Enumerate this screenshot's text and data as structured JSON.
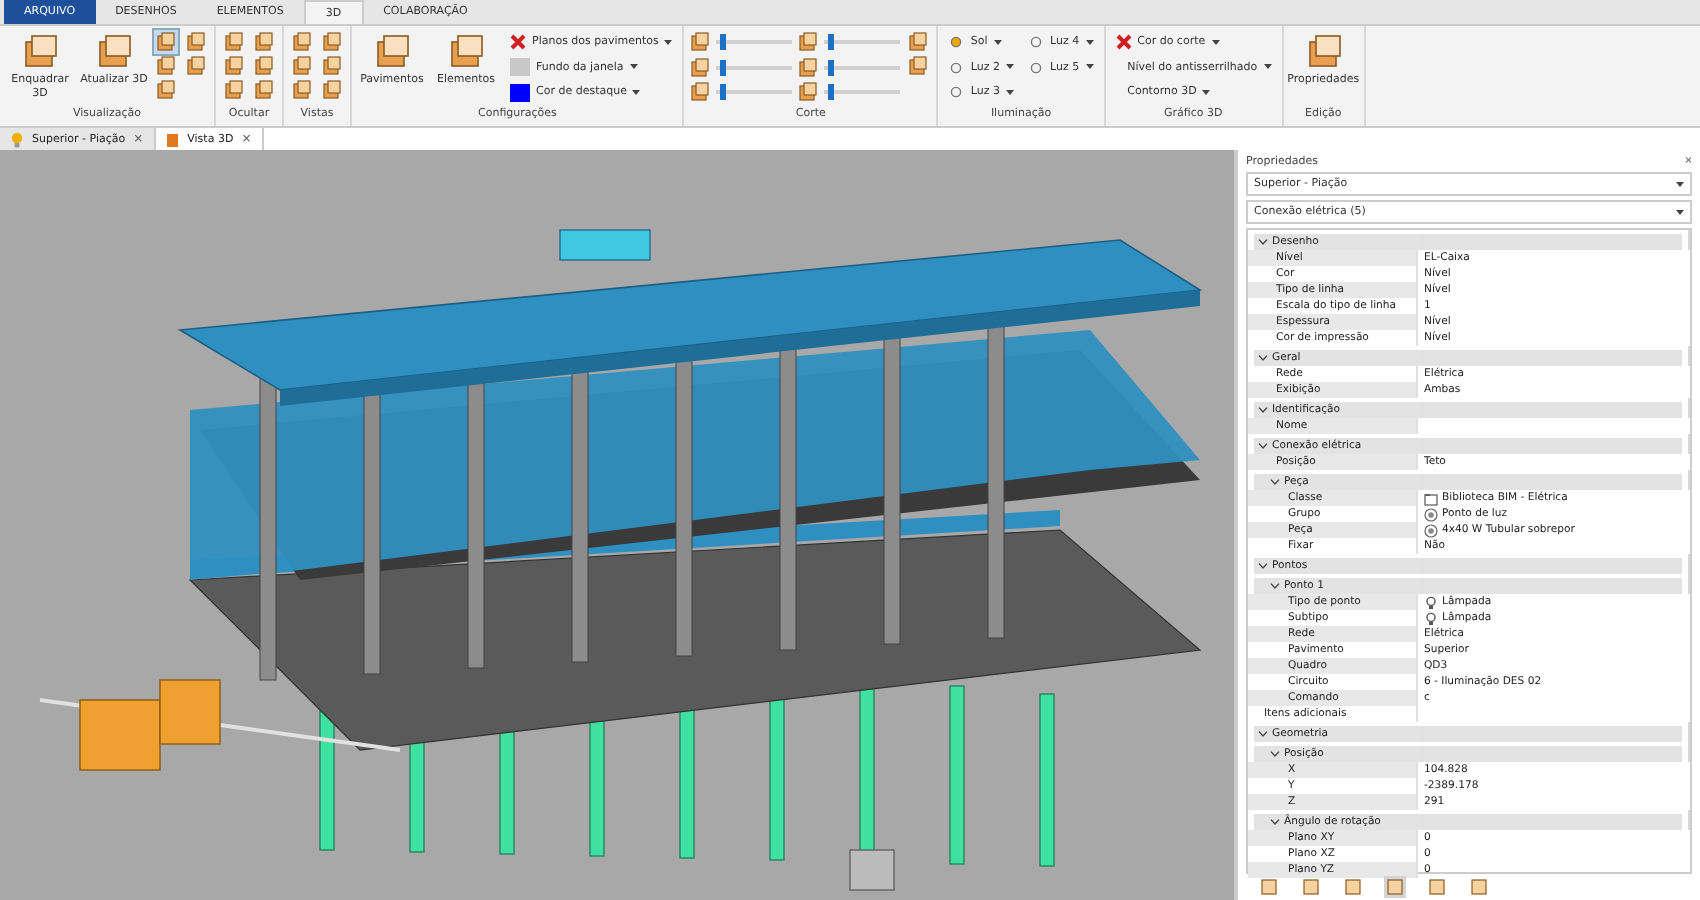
{
  "ribbon_tabs": [
    {
      "label": "ARQUIVO",
      "kind": "file",
      "selected": false
    },
    {
      "label": "DESENHOS",
      "kind": "tab",
      "selected": false
    },
    {
      "label": "ELEMENTOS",
      "kind": "tab",
      "selected": false
    },
    {
      "label": "3D",
      "kind": "tab",
      "selected": true
    },
    {
      "label": "COLABORAÇÃO",
      "kind": "tab",
      "selected": false
    }
  ],
  "ribbon_groups": [
    {
      "label": "Visualização",
      "controls": [
        {
          "kind": "large",
          "label": "Enquadrar 3D"
        },
        {
          "kind": "large",
          "label": "Atualizar 3D"
        },
        {
          "kind": "icon",
          "selected": true
        },
        {
          "kind": "icon",
          "selected": false
        },
        {
          "kind": "icon",
          "selected": false
        },
        {
          "kind": "icon",
          "selected": false
        },
        {
          "kind": "icon",
          "selected": false
        }
      ]
    },
    {
      "label": "Ocultar",
      "controls": [
        {
          "kind": "icon",
          "selected": false
        },
        {
          "kind": "icon",
          "selected": false
        },
        {
          "kind": "icon",
          "selected": false
        },
        {
          "kind": "icon",
          "selected": false
        },
        {
          "kind": "icon",
          "selected": false
        },
        {
          "kind": "icon",
          "selected": false
        }
      ]
    },
    {
      "label": "Vistas",
      "controls": [
        {
          "kind": "icon",
          "selected": false
        },
        {
          "kind": "icon",
          "selected": false
        },
        {
          "kind": "icon",
          "selected": false
        },
        {
          "kind": "icon",
          "selected": false
        },
        {
          "kind": "icon",
          "selected": false
        },
        {
          "kind": "icon",
          "selected": false
        }
      ]
    },
    {
      "label": "Configurações",
      "controls": [
        {
          "kind": "large",
          "label": "Pavimentos"
        },
        {
          "kind": "large",
          "label": "Elementos"
        },
        {
          "kind": "toggle",
          "label": "Planos dos pavimentos",
          "dropdown": true
        },
        {
          "kind": "swatch",
          "label": "Fundo da janela",
          "color": "#c8c8c8",
          "dropdown": true
        },
        {
          "kind": "swatch",
          "label": "Cor de destaque",
          "color": "#0000ff",
          "dropdown": true
        }
      ]
    },
    {
      "label": "Corte",
      "controls": [
        {
          "kind": "slider",
          "level": 0.05
        },
        {
          "kind": "slider",
          "level": 0.05
        },
        {
          "kind": "slider",
          "level": 0.05
        },
        {
          "kind": "slider",
          "level": 0.05
        },
        {
          "kind": "slider",
          "level": 0.05
        },
        {
          "kind": "slider",
          "level": 0.05
        },
        {
          "kind": "icon",
          "selected": false
        },
        {
          "kind": "icon",
          "selected": false
        }
      ]
    },
    {
      "label": "Iluminação",
      "controls": [
        {
          "kind": "menu",
          "label": "Sol",
          "dropdown": true
        },
        {
          "kind": "menu",
          "label": "Luz 2",
          "dropdown": true
        },
        {
          "kind": "menu",
          "label": "Luz 3",
          "dropdown": true
        },
        {
          "kind": "menu",
          "label": "Luz 4",
          "dropdown": true
        },
        {
          "kind": "menu",
          "label": "Luz 5",
          "dropdown": true
        }
      ]
    },
    {
      "label": "Gráfico 3D",
      "controls": [
        {
          "kind": "toggle",
          "label": "Cor do corte",
          "dropdown": true
        },
        {
          "kind": "text",
          "label": "Nível do antisserrilhado",
          "dropdown": true
        },
        {
          "kind": "text",
          "label": "Contorno 3D",
          "dropdown": true
        }
      ]
    },
    {
      "label": "Edição",
      "controls": [
        {
          "kind": "large",
          "label": "Propriedades"
        }
      ]
    }
  ],
  "document_tabs": [
    {
      "label": "Superior - Piação",
      "close": "×",
      "selected": false
    },
    {
      "label": "Vista 3D",
      "close": "×",
      "selected": true
    }
  ],
  "properties": {
    "title": "Propriedades",
    "close": "×",
    "floor_select": "Superior - Piação",
    "selection_select": "Conexão elétrica (5)",
    "rows": [
      {
        "kind": "group",
        "label": "Desenho",
        "expanded": true,
        "children": [
          {
            "kind": "text",
            "label": "Nível",
            "value": "EL-Caixa"
          },
          {
            "kind": "text",
            "label": "Cor",
            "value": "Nível"
          },
          {
            "kind": "text",
            "label": "Tipo de linha",
            "value": "Nível"
          },
          {
            "kind": "text",
            "label": "Escala do tipo de linha",
            "value": "1"
          },
          {
            "kind": "text",
            "label": "Espessura",
            "value": "Nível"
          },
          {
            "kind": "text",
            "label": "Cor de impressão",
            "value": "Nível"
          }
        ]
      },
      {
        "kind": "group",
        "label": "Geral",
        "expanded": true,
        "children": [
          {
            "kind": "text",
            "label": "Rede",
            "value": "Elétrica"
          },
          {
            "kind": "text",
            "label": "Exibição",
            "value": "Ambas"
          }
        ]
      },
      {
        "kind": "group",
        "label": "Identificação",
        "expanded": true,
        "children": [
          {
            "kind": "text",
            "label": "Nome"
          }
        ]
      },
      {
        "kind": "group",
        "label": "Conexão elétrica",
        "expanded": true,
        "children": [
          {
            "kind": "text",
            "label": "Posição",
            "value": "Teto"
          },
          {
            "kind": "group",
            "label": "Peça",
            "expanded": true,
            "children": [
              {
                "kind": "library",
                "label": "Classe",
                "value": "Biblioteca BIM - Elétrica"
              },
              {
                "kind": "part",
                "label": "Grupo",
                "value": "Ponto de luz"
              },
              {
                "kind": "part",
                "label": "Peça",
                "value": "4x40 W Tubular sobrepor"
              },
              {
                "kind": "text",
                "label": "Fixar",
                "value": "Não"
              }
            ]
          }
        ]
      },
      {
        "kind": "group",
        "label": "Pontos",
        "expanded": true,
        "children": [
          {
            "kind": "group",
            "label": "Ponto 1",
            "expanded": true,
            "children": [
              {
                "kind": "lamp",
                "label": "Tipo de ponto",
                "value": "Lâmpada"
              },
              {
                "kind": "lamp",
                "label": "Subtipo",
                "value": "Lâmpada"
              },
              {
                "kind": "text",
                "label": "Rede",
                "value": "Elétrica"
              },
              {
                "kind": "text",
                "label": "Pavimento",
                "value": "Superior"
              },
              {
                "kind": "text",
                "label": "Quadro",
                "value": "QD3"
              },
              {
                "kind": "text",
                "label": "Circuito",
                "value": "6 - Iluminação DES 02"
              },
              {
                "kind": "text",
                "label": "Comando",
                "value": "c"
              }
            ]
          }
        ]
      },
      {
        "kind": "text",
        "label": "Itens adicionais"
      },
      {
        "kind": "group",
        "label": "Geometria",
        "expanded": true,
        "children": [
          {
            "kind": "group",
            "label": "Posição",
            "expanded": true,
            "children": [
              {
                "kind": "text",
                "label": "X",
                "value": "104.828"
              },
              {
                "kind": "text",
                "label": "Y",
                "value": "-2389.178"
              },
              {
                "kind": "text",
                "label": "Z",
                "value": "291"
              }
            ]
          },
          {
            "kind": "group",
            "label": "Ângulo de rotação",
            "expanded": true,
            "children": [
              {
                "kind": "text",
                "label": "Plano XY",
                "value": "0"
              },
              {
                "kind": "text",
                "label": "Plano XZ",
                "value": "0"
              },
              {
                "kind": "text",
                "label": "Plano YZ",
                "value": "0"
              }
            ]
          }
        ]
      }
    ],
    "toolbar": [
      {
        "selected": false
      },
      {
        "selected": false
      },
      {
        "selected": false
      },
      {
        "selected": true
      },
      {
        "selected": false
      },
      {
        "selected": false
      }
    ]
  }
}
